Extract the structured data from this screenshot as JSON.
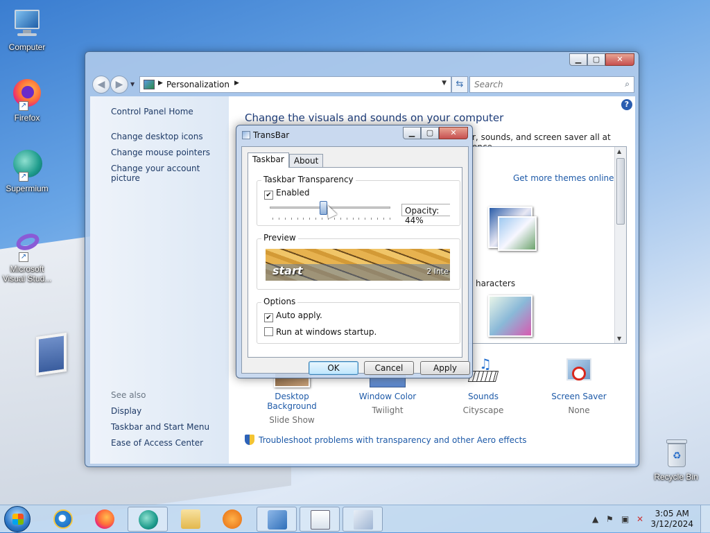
{
  "desktop": {
    "icons": [
      {
        "label": "Computer",
        "icon": "computer-icon"
      },
      {
        "label": "Firefox",
        "icon": "firefox-icon"
      },
      {
        "label": "Supermium",
        "icon": "supermium-icon"
      },
      {
        "label": "Microsoft Visual Stud...",
        "icon": "visual-studio-icon"
      },
      {
        "label": "Recycle Bin",
        "icon": "recycle-bin-icon"
      }
    ]
  },
  "window": {
    "breadcrumb": "Personalization",
    "search_placeholder": "Search",
    "left_links": [
      "Control Panel Home",
      "Change desktop icons",
      "Change mouse pointers",
      "Change your account picture"
    ],
    "see_also_title": "See also",
    "see_also_links": [
      "Display",
      "Taskbar and Start Menu",
      "Ease of Access Center"
    ],
    "main_title": "Change the visuals and sounds on your computer",
    "main_subtitle": "r, sounds, and screen saver all at once.",
    "themes_link": "Get more themes online",
    "theme_caption": "haracters",
    "bottom_items": [
      {
        "name": "Desktop Background",
        "sub": "Slide Show"
      },
      {
        "name": "Window Color",
        "sub": "Twilight"
      },
      {
        "name": "Sounds",
        "sub": "Cityscape"
      },
      {
        "name": "Screen Saver",
        "sub": "None"
      }
    ],
    "troubleshoot": "Troubleshoot problems with transparency and other Aero effects"
  },
  "dialog": {
    "title": "TransBar",
    "tabs": [
      "Taskbar",
      "About"
    ],
    "group_transparency": "Taskbar Transparency",
    "enabled_label": "Enabled",
    "enabled_checked": true,
    "opacity_text": "Opacity: 44%",
    "opacity_value": 44,
    "group_preview": "Preview",
    "preview_start": "start",
    "preview_tray": "2 Inte",
    "group_options": "Options",
    "auto_apply_label": "Auto apply.",
    "auto_apply_checked": true,
    "startup_label": "Run at windows startup.",
    "startup_checked": false,
    "buttons": {
      "ok": "OK",
      "cancel": "Cancel",
      "apply": "Apply"
    }
  },
  "taskbar": {
    "time": "3:05 AM",
    "date": "3/12/2024"
  },
  "colors": {
    "link": "#1e5aa8",
    "title_blue": "#1e3d7a"
  }
}
